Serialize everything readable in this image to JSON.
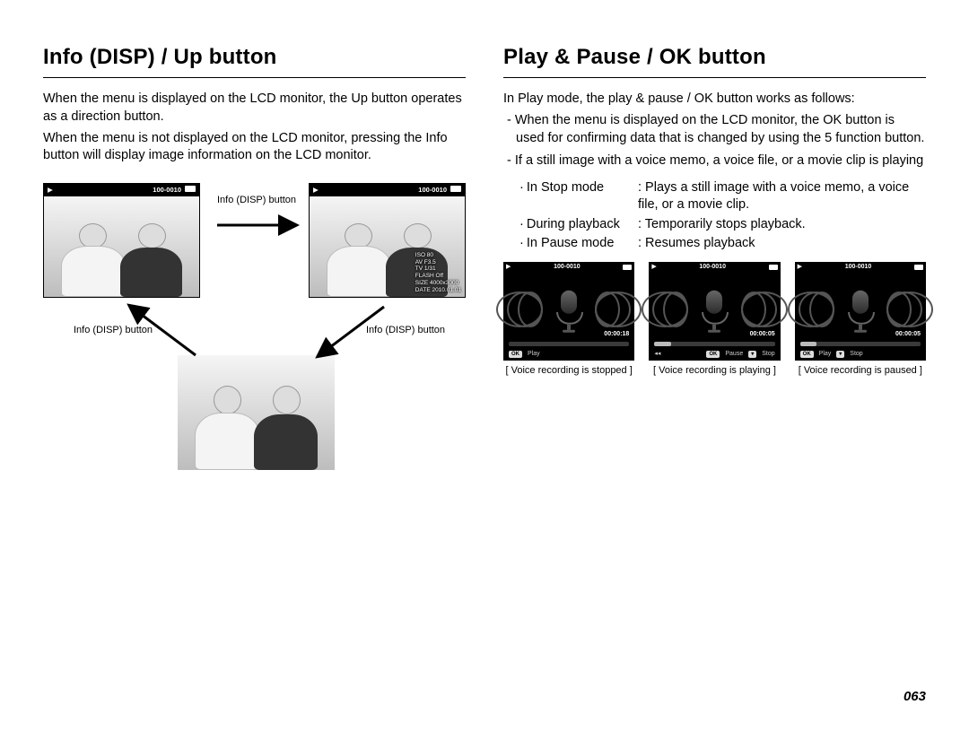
{
  "page_number": "063",
  "left": {
    "title": "Info (DISP) / Up button",
    "para1": "When the menu is displayed on the LCD monitor, the Up button operates as a direction button.",
    "para2": "When the menu is not displayed on the LCD monitor, pressing the Info button will display image information on the LCD monitor.",
    "arrow_label": "Info (DISP) button",
    "file_counter": "100-0010",
    "overlay": {
      "iso": "ISO 80",
      "av": "AV F3.5",
      "tv": "TV 1/31",
      "flash": "FLASH Off",
      "size": "SIZE 4000x3000",
      "date": "DATE 2010.01.01"
    }
  },
  "right": {
    "title": "Play & Pause / OK button",
    "intro": "In Play mode, the play & pause / OK button works as follows:",
    "bullets": [
      "When the menu is displayed on the LCD monitor, the OK button is used for confirming data that is changed by using the 5 function button.",
      "If a still image with a voice memo, a voice file, or a movie clip is playing"
    ],
    "modes": [
      {
        "label": "In Stop mode",
        "value": ": Plays a still image with a voice memo, a voice file, or a movie clip."
      },
      {
        "label": "During playback",
        "value": ": Temporarily stops playback."
      },
      {
        "label": "In Pause mode",
        "value": ": Resumes playback"
      }
    ],
    "voice": {
      "file_counter": "100-0010",
      "screens": [
        {
          "time": "00:00:18",
          "progress": 0,
          "ctrl1": "OK",
          "act1": "Play",
          "act2": "",
          "caption": "[ Voice recording is stopped ]"
        },
        {
          "time": "00:00:05",
          "progress": 14,
          "ctrl1": "OK",
          "act1": "Pause",
          "act2": "Stop",
          "caption": "[ Voice recording is playing ]"
        },
        {
          "time": "00:00:05",
          "progress": 14,
          "ctrl1": "OK",
          "act1": "Play",
          "act2": "Stop",
          "caption": "[ Voice recording is paused ]"
        }
      ]
    }
  }
}
